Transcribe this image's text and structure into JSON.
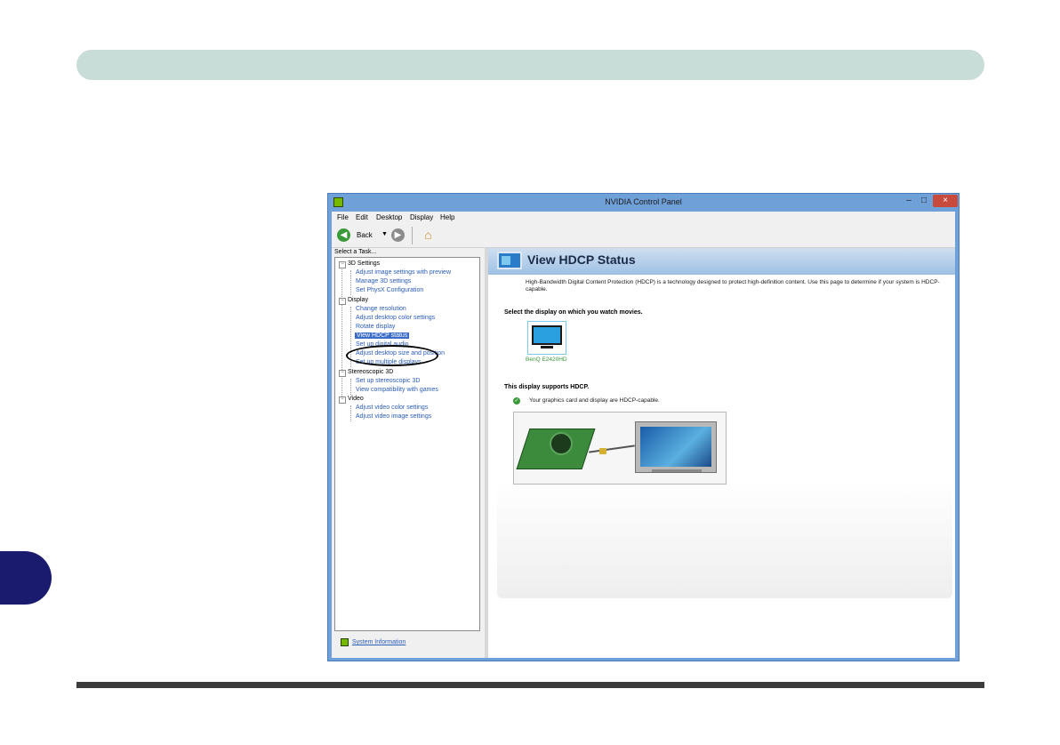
{
  "window": {
    "title": "NVIDIA Control Panel",
    "minimize": "–",
    "maximize": "□",
    "close": "×"
  },
  "menubar": {
    "items": [
      {
        "label": "File"
      },
      {
        "label": "Edit"
      },
      {
        "label": "Desktop"
      },
      {
        "label": "Display"
      },
      {
        "label": "Help"
      }
    ]
  },
  "toolbar": {
    "back_label": "Back",
    "back_glyph": "◀",
    "dropdown_glyph": "▼",
    "forward_glyph": "▶",
    "home_glyph": "⌂"
  },
  "left": {
    "select_task": "Select a Task...",
    "tree": [
      {
        "label": "3D Settings",
        "kind": "category"
      },
      {
        "label": "Adjust image settings with preview",
        "kind": "item"
      },
      {
        "label": "Manage 3D settings",
        "kind": "item"
      },
      {
        "label": "Set PhysX Configuration",
        "kind": "item"
      },
      {
        "label": "Display",
        "kind": "category"
      },
      {
        "label": "Change resolution",
        "kind": "item"
      },
      {
        "label": "Adjust desktop color settings",
        "kind": "item"
      },
      {
        "label": "Rotate display",
        "kind": "item"
      },
      {
        "label": "View HDCP status",
        "kind": "item",
        "selected": true
      },
      {
        "label": "Set up digital audio",
        "kind": "item"
      },
      {
        "label": "Adjust desktop size and position",
        "kind": "item"
      },
      {
        "label": "Set up multiple displays",
        "kind": "item"
      },
      {
        "label": "Stereoscopic 3D",
        "kind": "category"
      },
      {
        "label": "Set up stereoscopic 3D",
        "kind": "item"
      },
      {
        "label": "View compatibility with games",
        "kind": "item"
      },
      {
        "label": "Video",
        "kind": "category"
      },
      {
        "label": "Adjust video color settings",
        "kind": "item"
      },
      {
        "label": "Adjust video image settings",
        "kind": "item"
      }
    ],
    "system_information": "System Information"
  },
  "right": {
    "title": "View HDCP Status",
    "description": "High-Bandwidth Digital Content Protection (HDCP) is a technology designed to protect high-definition content. Use this page to determine if your system is HDCP-capable.",
    "select_heading": "Select the display on which you watch movies.",
    "display_name": "BenQ E2420HD",
    "supports_heading": "This display supports HDCP.",
    "capable_text": "Your graphics card and display are HDCP-capable.",
    "check_glyph": "✓"
  },
  "colors": {
    "header_band": "#c8dcd8",
    "side_tab": "#1a1a6e",
    "window_frame": "#6fa0d8",
    "close_button": "#c74a3c",
    "link": "#2a5cb8",
    "selection": "#3a6cc8",
    "nvidia_green": "#76b900"
  }
}
